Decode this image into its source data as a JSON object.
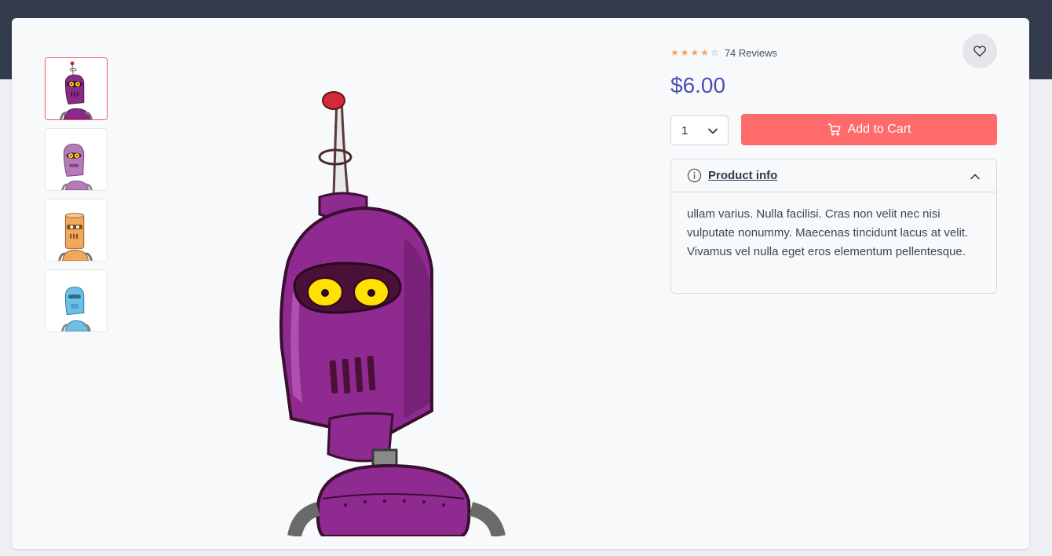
{
  "product": {
    "rating": 4,
    "rating_max": 5,
    "reviews_label": "74 Reviews",
    "price": "$6.00"
  },
  "purchase": {
    "quantity": "1",
    "add_to_cart_label": "Add to Cart",
    "add_to_cart_color": "#fe6b6a"
  },
  "info": {
    "title": "Product info",
    "body": "ullam varius. Nulla facilisi. Cras non velit nec nisi vulputate nonummy. Maecenas tincidunt lacus at velit. Vivamus vel nulla eget eros elementum pellentesque."
  },
  "gallery": {
    "thumbnails": [
      {
        "name": "purple-robot",
        "color": "#8b2a8c",
        "active": true
      },
      {
        "name": "pink-robot",
        "color": "#b77ab8",
        "active": false
      },
      {
        "name": "orange-robot",
        "color": "#f0a85a",
        "active": false
      },
      {
        "name": "blue-robot",
        "color": "#6cc0e6",
        "active": false
      }
    ],
    "main_image": "purple-robot"
  },
  "colors": {
    "price": "#4a4fb5",
    "stars": "#f4a261",
    "active_thumb_border": "#ef5b5b",
    "header_band": "#343b4c"
  },
  "icons": [
    "heart-icon",
    "cart-icon",
    "info-icon",
    "chevron-down-icon",
    "chevron-up-icon",
    "star-icon"
  ]
}
